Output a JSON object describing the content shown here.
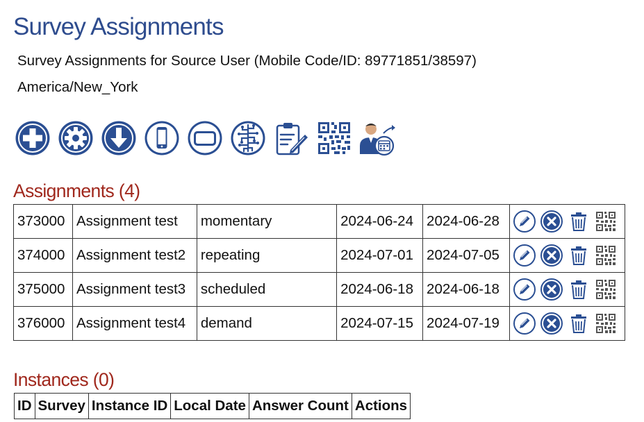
{
  "page": {
    "title": "Survey Assignments",
    "subtitle": "Survey Assignments for Source User (Mobile Code/ID: 89771851/38597)",
    "timezone": "America/New_York"
  },
  "toolbar": {
    "icons": [
      "plus-circle-icon",
      "gear-circle-icon",
      "download-circle-icon",
      "mobile-phone-icon",
      "tablet-icon",
      "circuit-brain-icon",
      "clipboard-edit-icon",
      "qr-code-icon",
      "user-calendar-icon"
    ]
  },
  "assignments": {
    "title": "Assignments (4)",
    "rows": [
      {
        "id": "373000",
        "name": "Assignment test",
        "type": "momentary",
        "start": "2024-06-24",
        "end": "2024-06-28"
      },
      {
        "id": "374000",
        "name": "Assignment test2",
        "type": "repeating",
        "start": "2024-07-01",
        "end": "2024-07-05"
      },
      {
        "id": "375000",
        "name": "Assignment test3",
        "type": "scheduled",
        "start": "2024-06-18",
        "end": "2024-06-18"
      },
      {
        "id": "376000",
        "name": "Assignment test4",
        "type": "demand",
        "start": "2024-07-15",
        "end": "2024-07-19"
      }
    ],
    "row_action_icons": [
      "edit-pencil-icon",
      "cancel-x-icon",
      "trash-icon",
      "qr-code-icon"
    ]
  },
  "instances": {
    "title": "Instances (0)",
    "columns": [
      "ID",
      "Survey",
      "Instance ID",
      "Local Date",
      "Answer Count",
      "Actions"
    ]
  },
  "colors": {
    "title_blue": "#2e4c8e",
    "icon_blue": "#2b4f93",
    "section_red": "#a0281d"
  }
}
